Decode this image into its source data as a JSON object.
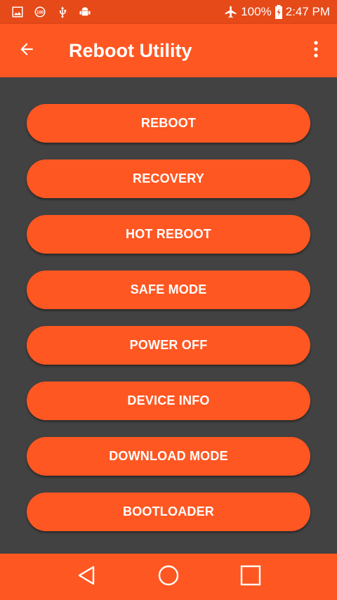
{
  "status_bar": {
    "left_icons": [
      "gallery-icon",
      "rating-100-icon",
      "usb-icon",
      "android-debug-icon"
    ],
    "airplane_icon": "airplane-icon",
    "battery_percent": "100%",
    "battery_icon": "battery-charging-icon",
    "time": "2:47 PM"
  },
  "app_bar": {
    "back_icon": "arrow-back-icon",
    "title": "Reboot Utility",
    "overflow_icon": "more-vert-icon"
  },
  "buttons": [
    {
      "label": "REBOOT"
    },
    {
      "label": "RECOVERY"
    },
    {
      "label": "HOT REBOOT"
    },
    {
      "label": "SAFE MODE"
    },
    {
      "label": "POWER OFF"
    },
    {
      "label": "DEVICE INFO"
    },
    {
      "label": "DOWNLOAD MODE"
    },
    {
      "label": "BOOTLOADER"
    }
  ],
  "nav_bar": {
    "back_icon": "nav-back-triangle-icon",
    "home_icon": "nav-home-circle-icon",
    "recents_icon": "nav-recents-square-icon"
  },
  "colors": {
    "primary": "#FF5722",
    "primary_dark": "#E64A19",
    "background": "#424242",
    "text_on_primary": "#FFFFFF"
  }
}
